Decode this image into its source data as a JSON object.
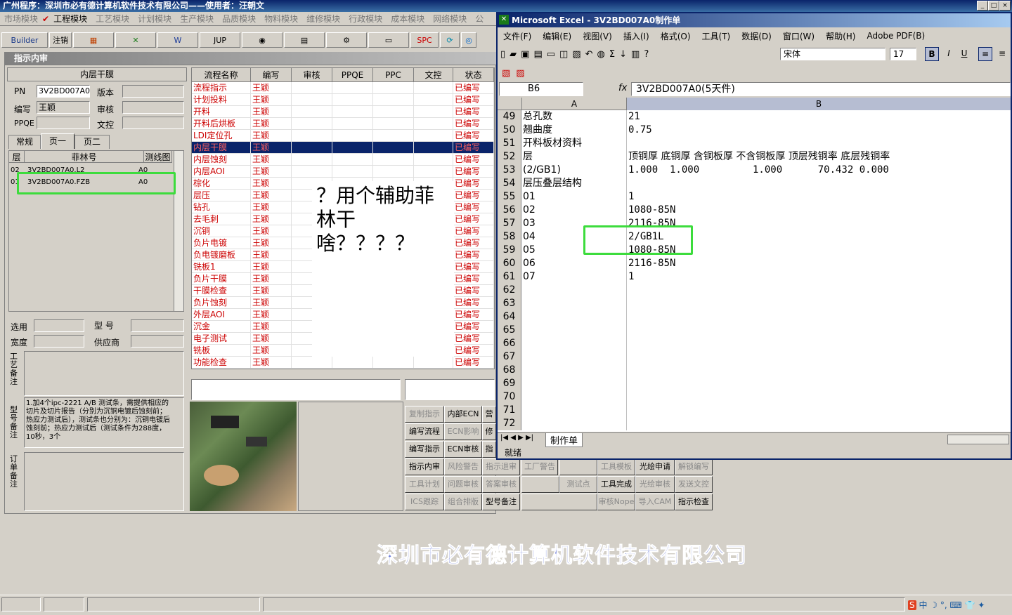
{
  "app": {
    "title": "广州程序：深圳市必有德计算机软件技术有限公司——使用者：汪朝文",
    "menus": [
      "市场模块",
      "工程模块",
      "工艺模块",
      "计划模块",
      "生产模块",
      "品质模块",
      "物料模块",
      "维修模块",
      "行政模块",
      "成本模块",
      "网络模块",
      "公"
    ],
    "toolbar": {
      "builder": "Builder",
      "logout": "注销",
      "jup": "JUP",
      "spc": "SPC"
    },
    "panel_title": "指示内审",
    "section_title": "内层干膜",
    "fields": {
      "pn_label": "PN",
      "pn_value": "3V2BD007A0",
      "version_label": "版本",
      "version_value": "",
      "writer_label": "编写",
      "writer_value": "王颖",
      "review_label": "审核",
      "review_value": "",
      "ppqe_label": "PPQE",
      "ppqe_value": "",
      "doc_label": "文控",
      "doc_value": ""
    },
    "tabs": [
      "常规",
      "页一",
      "页二"
    ],
    "film_table": {
      "headers": [
        "层",
        "菲林号",
        "测线图"
      ],
      "rows": [
        {
          "layer": "02",
          "film": "3V2BD007A0.L2",
          "chart": "A0"
        },
        {
          "layer": "01",
          "film": "3V2BD007A0.FZB",
          "chart": "A0"
        }
      ]
    },
    "bottom_fields": {
      "select_label": "选用",
      "model_label": "型 号",
      "width_label": "宽度",
      "supplier_label": "供应商",
      "craft_note_label": "工艺备注",
      "model_note_label": "型号备注",
      "order_note_label": "订单备注",
      "model_note_text": "1.加4个ipc-2221 A/B 测试条，需提供相应的切片及切片报告（分别为沉铜电镀后蚀刻前；热应力测试后），测试条也分别为：沉铜电镀后蚀刻前；热应力测试后（测试条件为288度，10秒，3个"
    },
    "flow_table": {
      "headers": [
        "流程名称",
        "编写",
        "审核",
        "PPQE",
        "PPC",
        "文控",
        "状态"
      ],
      "rows": [
        {
          "name": "流程指示",
          "writer": "王颖",
          "status": "已编写"
        },
        {
          "name": "计划投料",
          "writer": "王颖",
          "status": "已编写"
        },
        {
          "name": "开料",
          "writer": "王颖",
          "status": "已编写"
        },
        {
          "name": "开料后烘板",
          "writer": "王颖",
          "status": "已编写"
        },
        {
          "name": "LDI定位孔",
          "writer": "王颖",
          "status": "已编写"
        },
        {
          "name": "内层干膜",
          "writer": "王颖",
          "status": "已编写"
        },
        {
          "name": "内层蚀刻",
          "writer": "王颖",
          "status": "已编写"
        },
        {
          "name": "内层AOI",
          "writer": "王颖",
          "status": "已编写"
        },
        {
          "name": "棕化",
          "writer": "王颖",
          "status": "已编写"
        },
        {
          "name": "层压",
          "writer": "王颖",
          "status": "已编写"
        },
        {
          "name": "钻孔",
          "writer": "王颖",
          "status": "已编写"
        },
        {
          "name": "去毛刺",
          "writer": "王颖",
          "status": "已编写"
        },
        {
          "name": "沉铜",
          "writer": "王颖",
          "status": "已编写"
        },
        {
          "name": "负片电镀",
          "writer": "王颖",
          "status": "已编写"
        },
        {
          "name": "负电镀磨板",
          "writer": "王颖",
          "status": "已编写"
        },
        {
          "name": "铣板1",
          "writer": "王颖",
          "status": "已编写"
        },
        {
          "name": "负片干膜",
          "writer": "王颖",
          "status": "已编写"
        },
        {
          "name": "干膜检查",
          "writer": "王颖",
          "status": "已编写"
        },
        {
          "name": "负片蚀刻",
          "writer": "王颖",
          "status": "已编写"
        },
        {
          "name": "外层AOI",
          "writer": "王颖",
          "status": "已编写"
        },
        {
          "name": "沉金",
          "writer": "王颖",
          "status": "已编写"
        },
        {
          "name": "电子测试",
          "writer": "王颖",
          "status": "已编写"
        },
        {
          "name": "铣板",
          "writer": "王颖",
          "status": "已编写"
        },
        {
          "name": "功能检查",
          "writer": "王颖",
          "status": "已编写"
        }
      ]
    },
    "annotation": "？用个辅助菲林干啥？？？？",
    "buttons": [
      {
        "label": "复制指示",
        "dis": true
      },
      {
        "label": "内部ECN",
        "dis": false
      },
      {
        "label": "营",
        "dis": false
      },
      {
        "label": "编写流程",
        "dis": false
      },
      {
        "label": "ECN影响",
        "dis": true
      },
      {
        "label": "修",
        "dis": false
      },
      {
        "label": "编写指示",
        "dis": false
      },
      {
        "label": "ECN审核",
        "dis": false
      },
      {
        "label": "指",
        "dis": false
      },
      {
        "label": "指示内审",
        "dis": false
      },
      {
        "label": "风险警告",
        "dis": true
      },
      {
        "label": "指示退审",
        "dis": true
      },
      {
        "label": "工厂警告",
        "dis": true
      },
      {
        "label": "工具模板",
        "dis": true
      },
      {
        "label": "光绘申请",
        "dis": false
      },
      {
        "label": "解锁编写",
        "dis": true
      },
      {
        "label": "工具计划",
        "dis": true
      },
      {
        "label": "问题审核",
        "dis": true
      },
      {
        "label": "答案审核",
        "dis": true
      },
      {
        "label": "测试点",
        "dis": true
      },
      {
        "label": "工具完成",
        "dis": false
      },
      {
        "label": "光绘审核",
        "dis": true
      },
      {
        "label": "发送文控",
        "dis": true
      },
      {
        "label": "ICS跟踪",
        "dis": true
      },
      {
        "label": "组合排版",
        "dis": true
      },
      {
        "label": "型号备注",
        "dis": false
      },
      {
        "label": "审核Nope",
        "dis": true
      },
      {
        "label": "导入CAM",
        "dis": true
      },
      {
        "label": "指示检查",
        "dis": false
      }
    ],
    "company_banner": "深圳市必有德计算机软件技术有限公司"
  },
  "excel": {
    "title": "Microsoft Excel - 3V2BD007A0制作单",
    "menus": [
      "文件(F)",
      "编辑(E)",
      "视图(V)",
      "插入(I)",
      "格式(O)",
      "工具(T)",
      "数据(D)",
      "窗口(W)",
      "帮助(H)",
      "Adobe PDF(B)"
    ],
    "font_name": "宋体",
    "font_size": "17",
    "cell_ref": "B6",
    "fx": "fx",
    "formula": "3V2BD007A0(5天件)",
    "col_a": "A",
    "col_b": "B",
    "rows": [
      {
        "n": "49",
        "a": "总孔数",
        "b": "21"
      },
      {
        "n": "50",
        "a": "翘曲度",
        "b": "0.75"
      },
      {
        "n": "51",
        "a": "开料板材资料",
        "b": ""
      },
      {
        "n": "52",
        "a": "层",
        "b": "顶铜厚 底铜厚 含铜板厚 不含铜板厚 顶层残铜率 底层残铜率"
      },
      {
        "n": "53",
        "a": "(2/GB1)",
        "b": "1.000  1.000         1.000      70.432 0.000"
      },
      {
        "n": "54",
        "a": "层压叠层结构",
        "b": ""
      },
      {
        "n": "55",
        "a": "01",
        "b": "1"
      },
      {
        "n": "56",
        "a": "02",
        "b": "1080-85N"
      },
      {
        "n": "57",
        "a": "03",
        "b": "2116-85N"
      },
      {
        "n": "58",
        "a": "04",
        "b": "2/GB1L"
      },
      {
        "n": "59",
        "a": "05",
        "b": "1080-85N"
      },
      {
        "n": "60",
        "a": "06",
        "b": "2116-85N"
      },
      {
        "n": "61",
        "a": "07",
        "b": "1"
      },
      {
        "n": "62",
        "a": "",
        "b": ""
      },
      {
        "n": "63",
        "a": "",
        "b": ""
      },
      {
        "n": "64",
        "a": "",
        "b": ""
      },
      {
        "n": "65",
        "a": "",
        "b": ""
      },
      {
        "n": "66",
        "a": "",
        "b": ""
      },
      {
        "n": "67",
        "a": "",
        "b": ""
      },
      {
        "n": "68",
        "a": "",
        "b": ""
      },
      {
        "n": "69",
        "a": "",
        "b": ""
      },
      {
        "n": "70",
        "a": "",
        "b": ""
      },
      {
        "n": "71",
        "a": "",
        "b": ""
      },
      {
        "n": "72",
        "a": "",
        "b": ""
      }
    ],
    "sheet_tab": "制作单",
    "status": "就绪"
  },
  "colors": {
    "highlight": "#3cdc3c",
    "title_bg": "#0a246a",
    "flow_text": "#cc0000"
  }
}
